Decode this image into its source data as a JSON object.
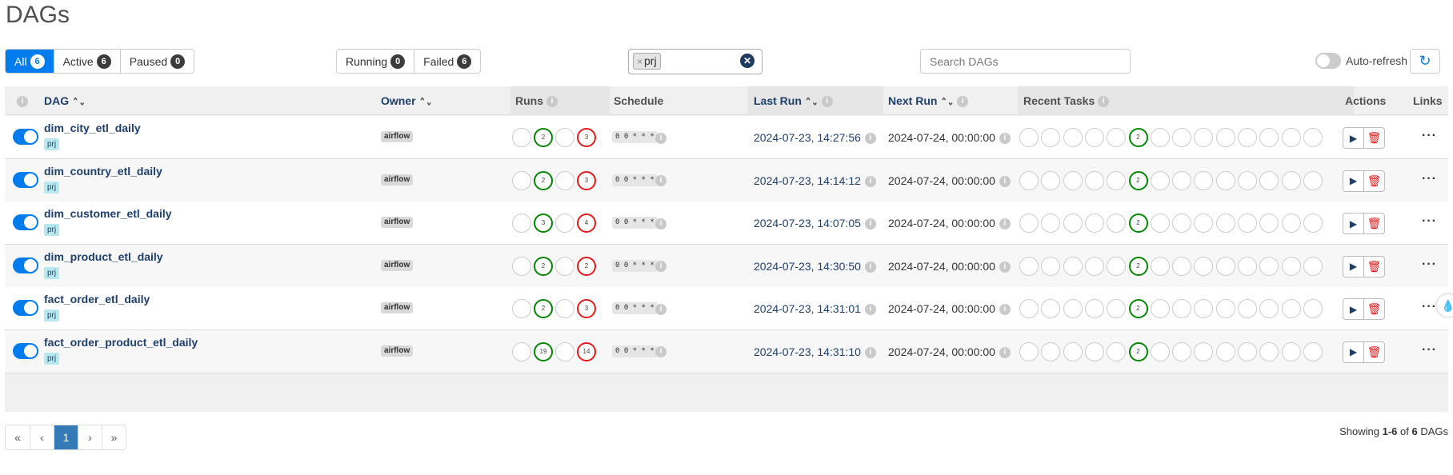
{
  "page": {
    "title": "DAGs"
  },
  "status_filters": [
    {
      "label": "All",
      "count": "6",
      "selected": true
    },
    {
      "label": "Active",
      "count": "6",
      "selected": false
    },
    {
      "label": "Paused",
      "count": "0",
      "selected": false
    }
  ],
  "run_filters": [
    {
      "label": "Running",
      "count": "0"
    },
    {
      "label": "Failed",
      "count": "6"
    }
  ],
  "tag_filter": {
    "remove_symbol": "×",
    "value": "prj",
    "clear_symbol": "✕"
  },
  "search": {
    "placeholder": "Search DAGs"
  },
  "auto_refresh": {
    "label": "Auto-refresh",
    "enabled": false
  },
  "refresh": {
    "icon": "refresh-icon",
    "glyph": "↻"
  },
  "columns": {
    "info": "i",
    "dag": "DAG",
    "owner": "Owner",
    "runs": "Runs",
    "schedule": "Schedule",
    "last_run": "Last Run",
    "next_run": "Next Run",
    "recent_tasks": "Recent Tasks",
    "actions": "Actions",
    "links": "Links"
  },
  "symbols": {
    "sort": "⌃⌄",
    "info": "i",
    "play": "▶",
    "trash": "🗑",
    "more": "···",
    "droplet": "💧"
  },
  "rows": [
    {
      "name": "dim_city_etl_daily",
      "tag": "prj",
      "owner": "airflow",
      "runs": [
        "",
        "2",
        "",
        "3"
      ],
      "schedule": "0 0 * * *",
      "last_run": "2024-07-23, 14:27:56",
      "next_run": "2024-07-24, 00:00:00",
      "recent_task_success": "2"
    },
    {
      "name": "dim_country_etl_daily",
      "tag": "prj",
      "owner": "airflow",
      "runs": [
        "",
        "2",
        "",
        "3"
      ],
      "schedule": "0 0 * * *",
      "last_run": "2024-07-23, 14:14:12",
      "next_run": "2024-07-24, 00:00:00",
      "recent_task_success": "2"
    },
    {
      "name": "dim_customer_etl_daily",
      "tag": "prj",
      "owner": "airflow",
      "runs": [
        "",
        "3",
        "",
        "4"
      ],
      "schedule": "0 0 * * *",
      "last_run": "2024-07-23, 14:07:05",
      "next_run": "2024-07-24, 00:00:00",
      "recent_task_success": "2"
    },
    {
      "name": "dim_product_etl_daily",
      "tag": "prj",
      "owner": "airflow",
      "runs": [
        "",
        "2",
        "",
        "2"
      ],
      "schedule": "0 0 * * *",
      "last_run": "2024-07-23, 14:30:50",
      "next_run": "2024-07-24, 00:00:00",
      "recent_task_success": "2"
    },
    {
      "name": "fact_order_etl_daily",
      "tag": "prj",
      "owner": "airflow",
      "runs": [
        "",
        "2",
        "",
        "3"
      ],
      "schedule": "0 0 * * *",
      "last_run": "2024-07-23, 14:31:01",
      "next_run": "2024-07-24, 00:00:00",
      "recent_task_success": "2"
    },
    {
      "name": "fact_order_product_etl_daily",
      "tag": "prj",
      "owner": "airflow",
      "runs": [
        "",
        "19",
        "",
        "14"
      ],
      "schedule": "0 0 * * *",
      "last_run": "2024-07-23, 14:31:10",
      "next_run": "2024-07-24, 00:00:00",
      "recent_task_success": "2"
    }
  ],
  "pagination": {
    "first": "«",
    "prev": "‹",
    "current": "1",
    "next": "›",
    "last": "»"
  },
  "showing": {
    "prefix": "Showing ",
    "range": "1-6",
    "of": " of ",
    "total": "6",
    "suffix": " DAGs"
  },
  "colors": {
    "accent": "#017cee",
    "success": "#038703",
    "failed": "#e21a1a",
    "dag_link": "#1f3f6b"
  }
}
